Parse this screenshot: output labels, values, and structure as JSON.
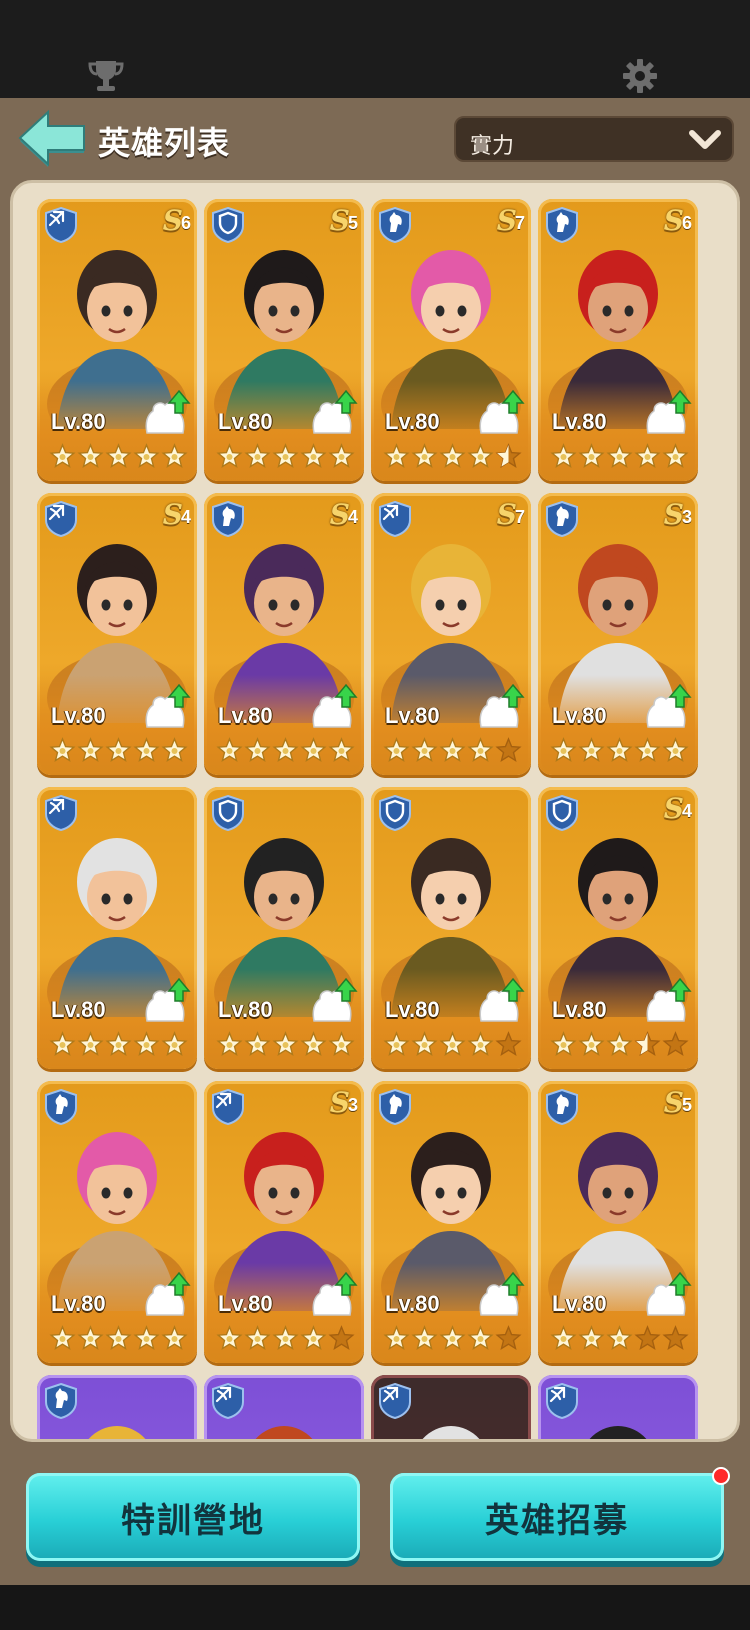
{
  "topbar": {
    "left_icon": "trophy-icon",
    "right_icon": "gear-icon"
  },
  "header": {
    "back_icon": "back-arrow-icon",
    "title": "英雄列表",
    "sort": {
      "value": "實力",
      "icon": "chevron-down-icon"
    }
  },
  "colors": {
    "card_gold": "#e9a024",
    "card_purple": "#8a5ce0",
    "button": "#35d4dc",
    "panel": "#7d6a55",
    "list_bg": "#e9dec8"
  },
  "heroes": [
    {
      "class": "crossbow",
      "rank": "6",
      "level": "Lv.80",
      "stars": 5,
      "theme": "gold"
    },
    {
      "class": "shield",
      "rank": "5",
      "level": "Lv.80",
      "stars": 5,
      "theme": "gold"
    },
    {
      "class": "horse",
      "rank": "7",
      "level": "Lv.80",
      "stars": 4.5,
      "theme": "gold"
    },
    {
      "class": "horse",
      "rank": "6",
      "level": "Lv.80",
      "stars": 5,
      "theme": "gold"
    },
    {
      "class": "crossbow",
      "rank": "4",
      "level": "Lv.80",
      "stars": 5,
      "theme": "gold"
    },
    {
      "class": "horse",
      "rank": "4",
      "level": "Lv.80",
      "stars": 5,
      "theme": "gold"
    },
    {
      "class": "crossbow",
      "rank": "7",
      "level": "Lv.80",
      "stars": 4,
      "theme": "gold"
    },
    {
      "class": "horse",
      "rank": "3",
      "level": "Lv.80",
      "stars": 5,
      "theme": "gold"
    },
    {
      "class": "crossbow",
      "rank": "",
      "level": "Lv.80",
      "stars": 5,
      "theme": "gold"
    },
    {
      "class": "shield",
      "rank": "",
      "level": "Lv.80",
      "stars": 5,
      "theme": "gold"
    },
    {
      "class": "shield",
      "rank": "",
      "level": "Lv.80",
      "stars": 4,
      "theme": "gold"
    },
    {
      "class": "shield",
      "rank": "4",
      "level": "Lv.80",
      "stars": 3.5,
      "theme": "gold"
    },
    {
      "class": "horse",
      "rank": "",
      "level": "Lv.80",
      "stars": 5,
      "theme": "gold"
    },
    {
      "class": "crossbow",
      "rank": "3",
      "level": "Lv.80",
      "stars": 4,
      "theme": "gold"
    },
    {
      "class": "horse",
      "rank": "",
      "level": "Lv.80",
      "stars": 4,
      "theme": "gold"
    },
    {
      "class": "horse",
      "rank": "5",
      "level": "Lv.80",
      "stars": 3,
      "theme": "gold"
    },
    {
      "class": "horse",
      "rank": "",
      "level": "",
      "stars": 0,
      "theme": "purple"
    },
    {
      "class": "crossbow",
      "rank": "",
      "level": "",
      "stars": 0,
      "theme": "purple"
    },
    {
      "class": "crossbow",
      "rank": "",
      "level": "",
      "stars": 0,
      "theme": "dark"
    },
    {
      "class": "crossbow",
      "rank": "",
      "level": "",
      "stars": 0,
      "theme": "purple"
    }
  ],
  "rank_letter": "S",
  "buttons": {
    "train": "特訓營地",
    "recruit": "英雄招募"
  }
}
